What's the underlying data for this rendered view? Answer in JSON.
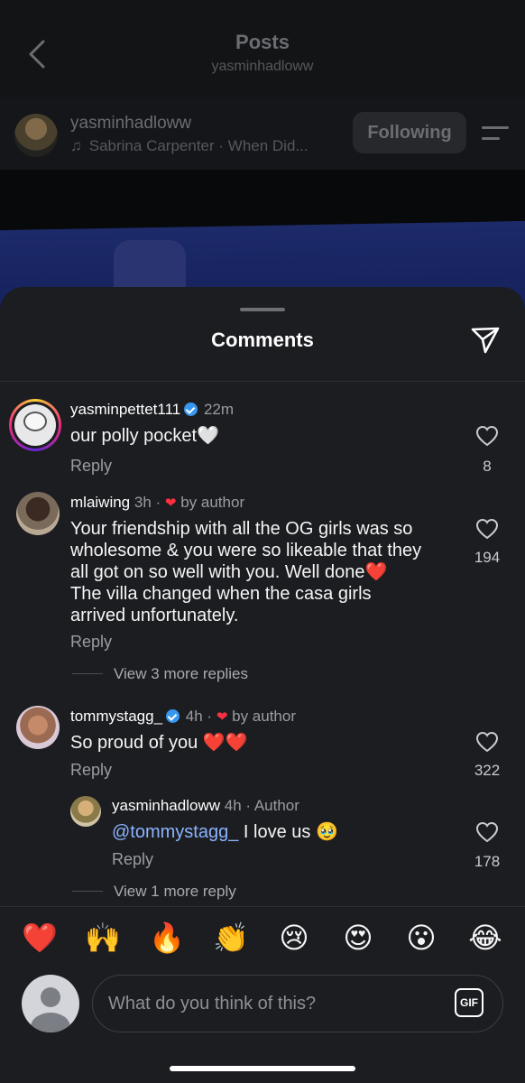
{
  "header": {
    "title": "Posts",
    "subtitle": "yasminhadloww"
  },
  "author_bar": {
    "username": "yasminhadloww",
    "music_note": "♫",
    "music": "Sabrina Carpenter · When Did...",
    "follow_button": "Following"
  },
  "sheet": {
    "title": "Comments"
  },
  "comments": [
    {
      "username": "yasminpettet111",
      "verified": true,
      "time": "22m",
      "text": "our polly pocket🤍",
      "reply_label": "Reply",
      "likes": "8"
    },
    {
      "username": "mlaiwing",
      "time": "3h ·",
      "liked_by_author_mark": "❤",
      "liked_by_author": "by author",
      "text_lines": [
        "Your friendship with all the OG girls was so",
        "wholesome & you were so likeable that they",
        "all got on so well with you. Well done❤️",
        "The villa changed when the casa girls",
        "arrived unfortunately."
      ],
      "reply_label": "Reply",
      "likes": "194",
      "view_more": "View 3 more replies"
    },
    {
      "username": "tommystagg_",
      "verified": true,
      "time": "4h ·",
      "liked_by_author_mark": "❤",
      "liked_by_author": "by author",
      "text": "So proud of you ❤️❤️",
      "reply_label": "Reply",
      "likes": "322",
      "replies": [
        {
          "username": "yasminhadloww",
          "time": "4h · Author",
          "mention": "@tommystagg_",
          "text": " I love us 🥹",
          "reply_label": "Reply",
          "likes": "178"
        }
      ],
      "view_more": "View 1 more reply"
    }
  ],
  "emoji_bar": [
    "❤️",
    "🙌",
    "🔥",
    "👏",
    "😢",
    "😍",
    "😮",
    "😂"
  ],
  "composer": {
    "placeholder": "What do you think of this?",
    "gif_label": "GIF"
  },
  "colors": {
    "sheet_bg": "#1c1d21",
    "like_red": "#ff3040",
    "verified_blue": "#3797f0",
    "mention_blue": "#8ab4ff"
  }
}
